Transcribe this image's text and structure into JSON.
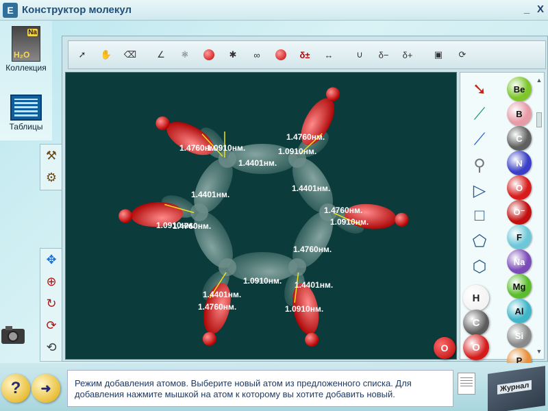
{
  "window": {
    "title": "Конструктор молекул",
    "logo": "Е",
    "minimize": "_",
    "close": "X"
  },
  "left_panel": {
    "collection_label": "Коллекция",
    "collection_icon_text": "H₂O",
    "collection_badge": "Na",
    "tables_label": "Таблицы"
  },
  "toolbar": {
    "items": [
      "select-icon",
      "hand-icon",
      "eraser-icon",
      "bond-angle-icon",
      "molecule-icon",
      "water-molecule-icon",
      "orbital-fan-icon",
      "orbital-p-icon",
      "charge-atom-icon",
      "dipole-icon",
      "bond-length-icon",
      "potential-well-icon",
      "negative-charge-icon",
      "positive-charge-icon",
      "photo-icon",
      "rotate-model-icon"
    ],
    "delta_label": "δ±"
  },
  "molecule": {
    "bond_labels": [
      "1.4760нм.",
      "1.0910нм.",
      "1.4401нм.",
      "1.4760нм.",
      "1.0910нм.",
      "1.4401нм.",
      "1.4401нм.",
      "1.4760нм.",
      "1.0910нм.",
      "1.4760нм.",
      "1.0910нм.",
      "1.4401нм.",
      "1.4401нм.",
      "1.0910нм.",
      "1.4760нм.",
      "1.0910нм.",
      "1.4760нм."
    ]
  },
  "palette": {
    "tools": [
      "arrow-tool-icon",
      "green-bond-icon",
      "blue-bond-icon",
      "ball-stick-icon",
      "triangle-shape-icon",
      "square-shape-icon",
      "pentagon-shape-icon",
      "hexagon-shape-icon"
    ],
    "elements": [
      {
        "symbol": "Be",
        "color": "#7ec62a"
      },
      {
        "symbol": "B",
        "color": "#e89aa6"
      },
      {
        "symbol": "C",
        "color": "#606060"
      },
      {
        "symbol": "N",
        "color": "#3b3fc7"
      },
      {
        "symbol": "O",
        "color": "#d81c1c"
      },
      {
        "symbol": "O⁻",
        "color": "#c21010"
      },
      {
        "symbol": "F",
        "color": "#6cc7d8"
      },
      {
        "symbol": "Na",
        "color": "#7b4bb8"
      },
      {
        "symbol": "Mg",
        "color": "#5bbd2c"
      },
      {
        "symbol": "Al",
        "color": "#3fb5c9"
      },
      {
        "symbol": "Si",
        "color": "#8a8a8a"
      },
      {
        "symbol": "P",
        "color": "#e8903a"
      }
    ],
    "quick": [
      {
        "symbol": "H",
        "color": "#f4f4f4"
      },
      {
        "symbol": "C",
        "color": "#5c5c5c"
      },
      {
        "symbol": "O",
        "color": "#d41a1a"
      }
    ],
    "scroll_up": "▲",
    "scroll_down": "▼"
  },
  "selected_atom": "O",
  "status": {
    "message": "Режим добавления атомов. Выберите новый атом из предложенного списка. Для добавления нажмите мышкой на атом к которому вы хотите добавить новый."
  },
  "bottom": {
    "help": "?",
    "journal": "Журнал"
  }
}
